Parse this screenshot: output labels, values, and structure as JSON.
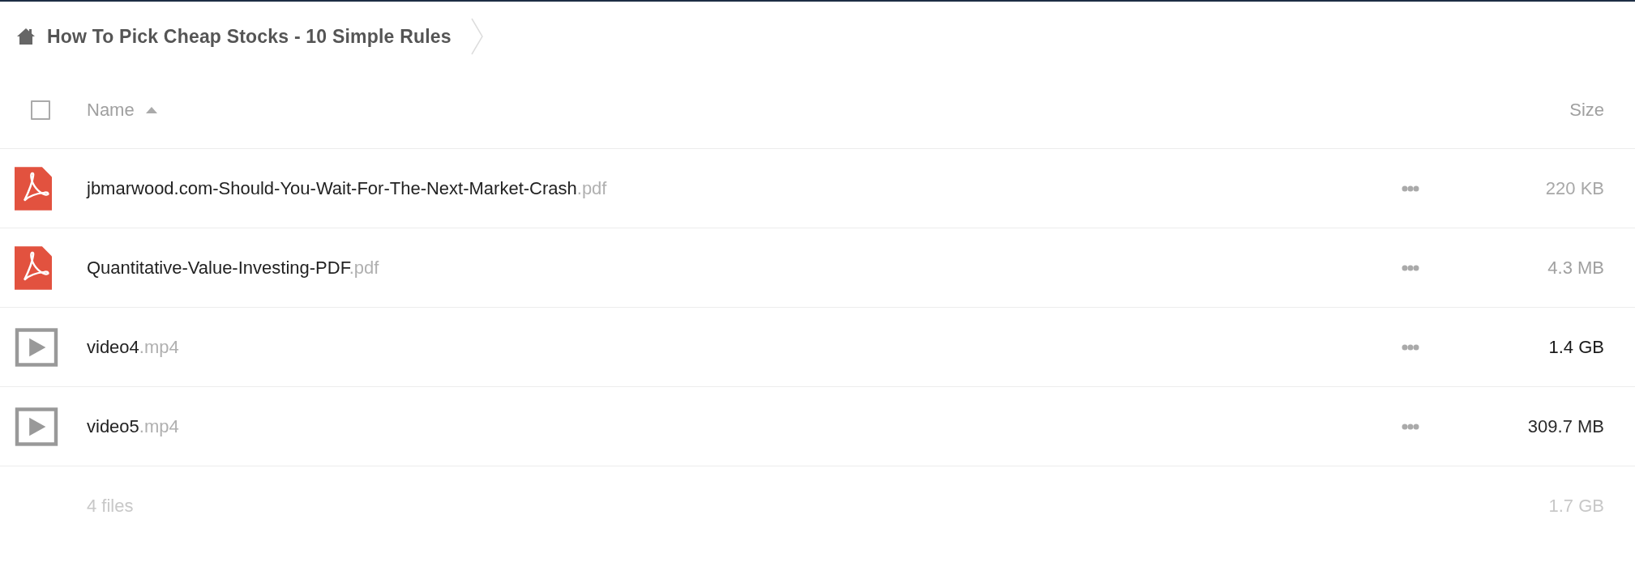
{
  "breadcrumb": {
    "title": "How To Pick Cheap Stocks - 10 Simple Rules"
  },
  "table": {
    "header": {
      "select_all_checked": false,
      "name": "Name",
      "sorted_ascending": true,
      "size": "Size"
    },
    "rows": [
      {
        "kind": "pdf",
        "name": "jbmarwood.com-Should-You-Wait-For-The-Next-Market-Crash",
        "extension": ".pdf",
        "size": "220 KB",
        "color": "#a8a8a8"
      },
      {
        "kind": "pdf",
        "name": "Quantitative-Value-Investing-PDF",
        "extension": ".pdf",
        "size": "4.3 MB",
        "color": "#a0a0a0"
      },
      {
        "kind": "video",
        "name": "video4",
        "extension": ".mp4",
        "size": "1.4 GB",
        "color": "#1a1a1a"
      },
      {
        "kind": "video",
        "name": "video5",
        "extension": ".mp4",
        "size": "309.7 MB",
        "color": "#2a2a2a"
      }
    ],
    "summary": {
      "count": "4 files",
      "size": "1.7 GB"
    }
  }
}
